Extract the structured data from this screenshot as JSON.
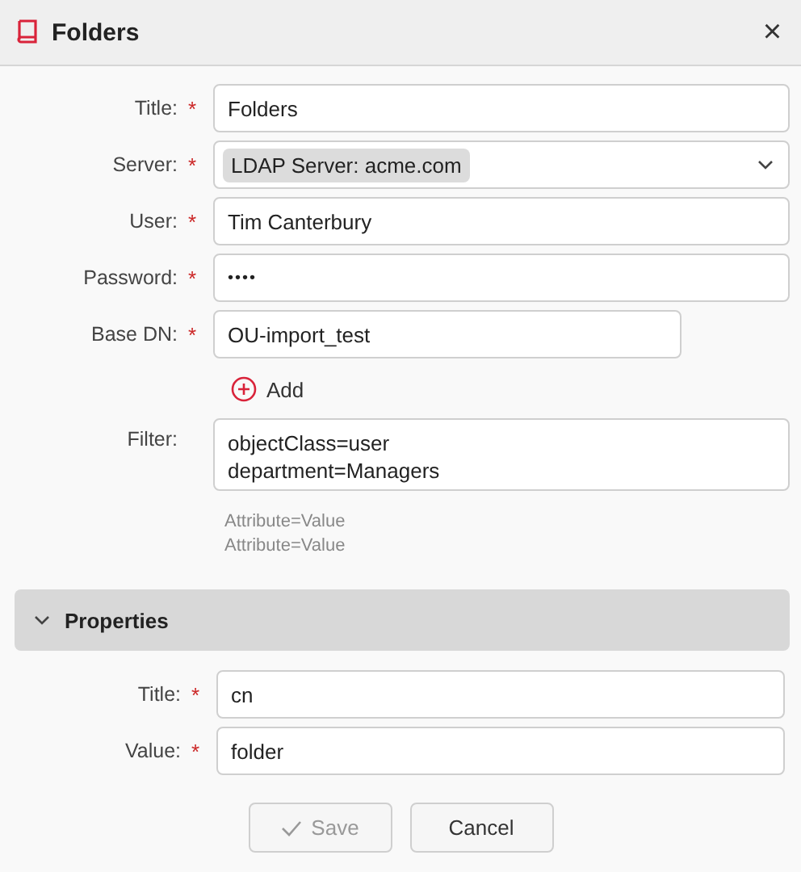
{
  "window": {
    "title": "Folders",
    "close": "×"
  },
  "fields": [
    {
      "label": "Title:",
      "marker": "*",
      "kind": "text",
      "value": "Folders",
      "compact": false
    },
    {
      "label": "Server:",
      "marker": "*",
      "kind": "select",
      "value": "LDAP Server: acme.com",
      "compact": false
    },
    {
      "label": "User:",
      "marker": "*",
      "kind": "text",
      "value": "Tim Canterbury",
      "compact": false
    },
    {
      "label": "Password:",
      "marker": "*",
      "kind": "password",
      "value": "••••",
      "compact": false
    },
    {
      "label": "Base DN:",
      "marker": "*",
      "kind": "text",
      "value": "OU-import_test",
      "compact": true
    }
  ],
  "add_button": {
    "label": "Add"
  },
  "filter": {
    "label": "Filter:",
    "lines": [
      "objectClass=user",
      "department=Managers"
    ],
    "hints": [
      "Attribute=Value",
      "Attribute=Value"
    ]
  },
  "properties": {
    "title": "Properties",
    "expanded": true,
    "fields": [
      {
        "label": "Title:",
        "marker": "*",
        "value": "cn"
      },
      {
        "label": "Value:",
        "marker": "*",
        "value": "folder"
      }
    ]
  },
  "buttons": [
    {
      "kind": "save",
      "label": "Save",
      "disabled": true
    },
    {
      "kind": "cancel",
      "label": "Cancel",
      "disabled": false
    }
  ]
}
